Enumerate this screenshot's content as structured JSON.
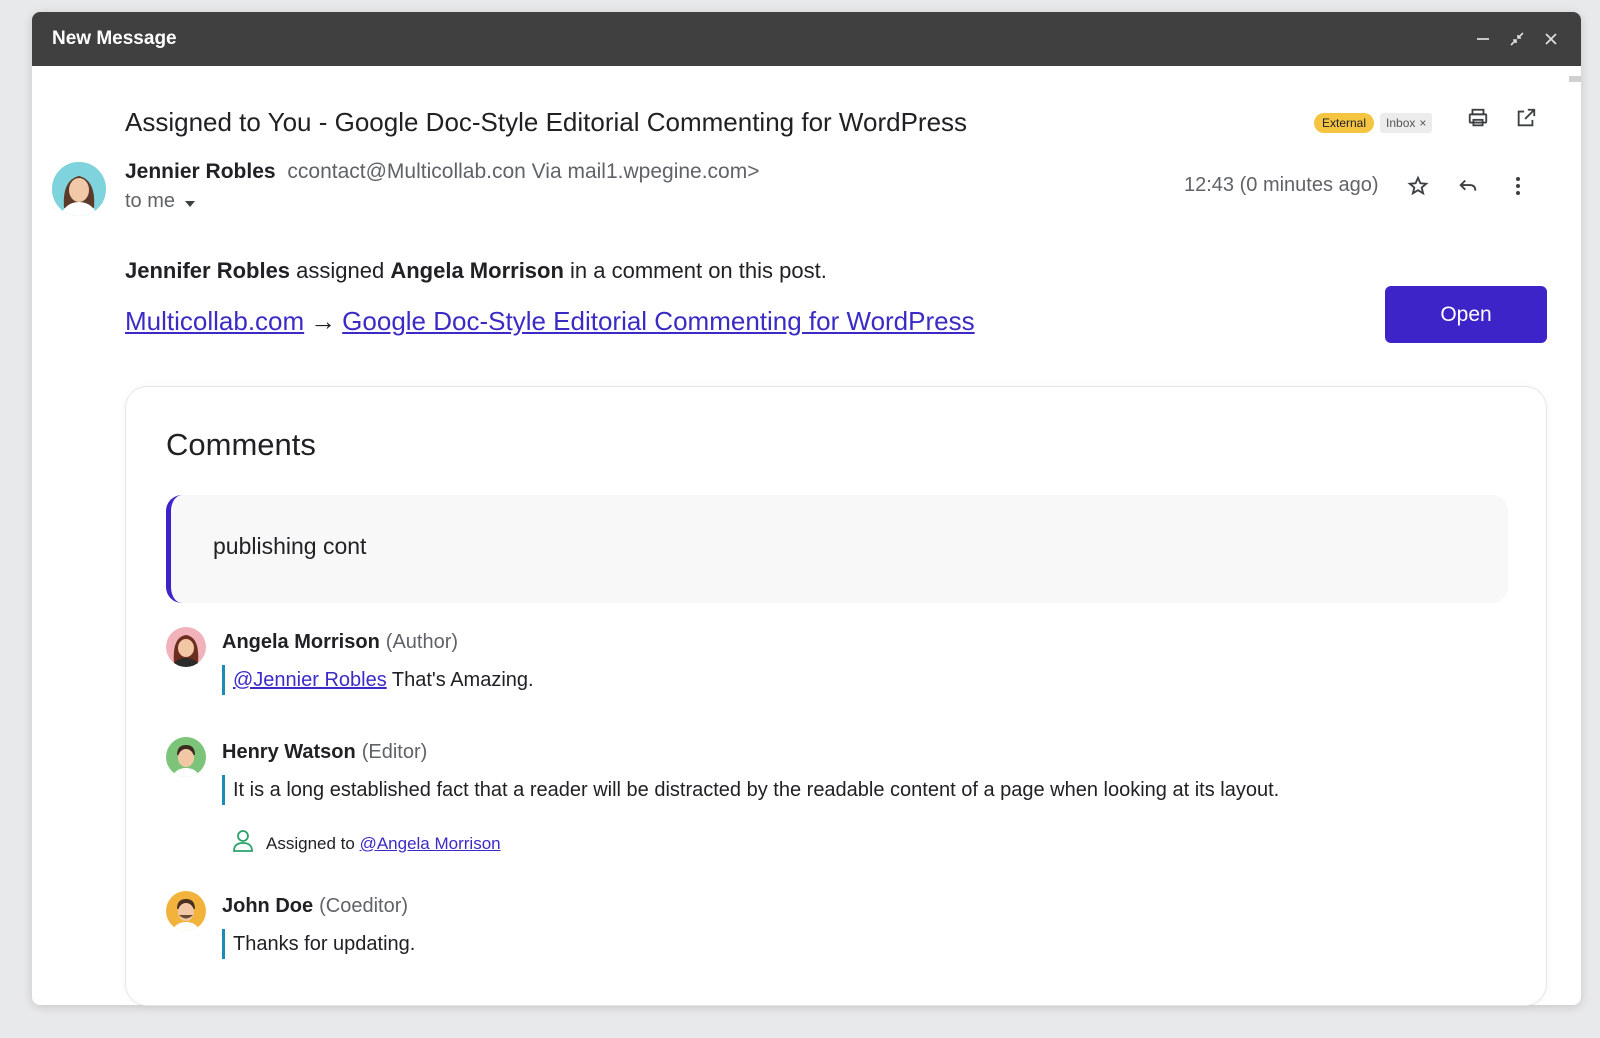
{
  "window": {
    "title": "New Message"
  },
  "email": {
    "subject": "Assigned to You -  Google Doc-Style Editorial Commenting for WordPress",
    "labels": {
      "external": "External",
      "inbox": "Inbox",
      "inbox_remove": "×"
    },
    "sender": {
      "name": "Jennier Robles",
      "email": "ccontact@Multicollab.con Via mail1.wpegine.com>"
    },
    "to": "to me",
    "time": "12:43 (0 minutes ago)",
    "body": {
      "assigner": "Jennifer Robles",
      "assigned_word": " assigned ",
      "assignee": "Angela Morrison",
      "rest": " in a comment on this post.",
      "site_link": "Multicollab.com",
      "arrow": "→",
      "post_link": "Google Doc-Style Editorial Commenting for WordPress"
    },
    "open_button": "Open"
  },
  "comments": {
    "title": "Comments",
    "quote": "publishing cont",
    "items": [
      {
        "name": "Angela Morrison",
        "role": "(Author)",
        "mention": "@Jennier Robles",
        "text": " That's Amazing."
      },
      {
        "name": "Henry Watson",
        "role": "(Editor)",
        "text": "It is a long established fact that a reader will be distracted by the readable content of a page when looking at its layout.",
        "assigned_label": "Assigned to ",
        "assigned_mention": "@Angela Morrison"
      },
      {
        "name": "John Doe",
        "role": "(Coeditor)",
        "text": "Thanks for updating."
      }
    ]
  },
  "colors": {
    "accent": "#3c24c8",
    "link": "#3b2bc6",
    "comment_bar": "#1b8cb8",
    "external_badge": "#f5c542"
  }
}
